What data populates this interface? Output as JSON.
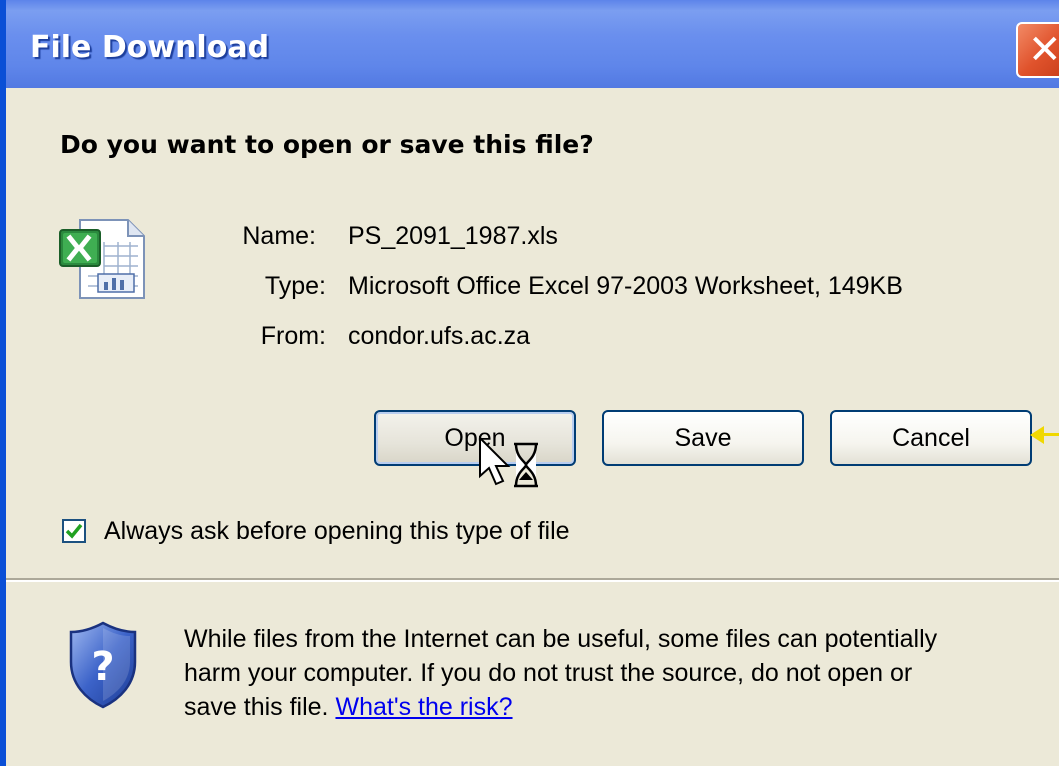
{
  "window": {
    "title": "File Download",
    "close_label": "✕"
  },
  "dialog": {
    "question": "Do you want to open or save this file?",
    "file": {
      "name_label": "Name:",
      "name_value": "PS_2091_1987.xls",
      "type_label": "Type:",
      "type_value": "Microsoft Office Excel 97-2003 Worksheet, 149KB",
      "from_label": "From:",
      "from_value": "condor.ufs.ac.za"
    },
    "buttons": {
      "open": "Open",
      "save": "Save",
      "cancel": "Cancel"
    },
    "always_ask": {
      "label": "Always ask before opening this type of file",
      "checked": true
    },
    "warning": {
      "line1": "While files from the Internet can be useful, some files can potentially",
      "line2": "harm your computer. If you do not trust the source, do not open or",
      "line3": "save this file.",
      "link": "What's the risk?"
    }
  },
  "colors": {
    "titlebar": "#5f86ea",
    "window_bg": "#ece9d8",
    "button_border": "#003c74",
    "link": "#0000ee",
    "close_button": "#e0532c",
    "annotation_arrow": "#f0d800"
  },
  "icons": {
    "file_icon": "excel-file-icon",
    "security_icon": "shield-question-icon",
    "cursor_icon": "arrow-hourglass-cursor-icon"
  }
}
